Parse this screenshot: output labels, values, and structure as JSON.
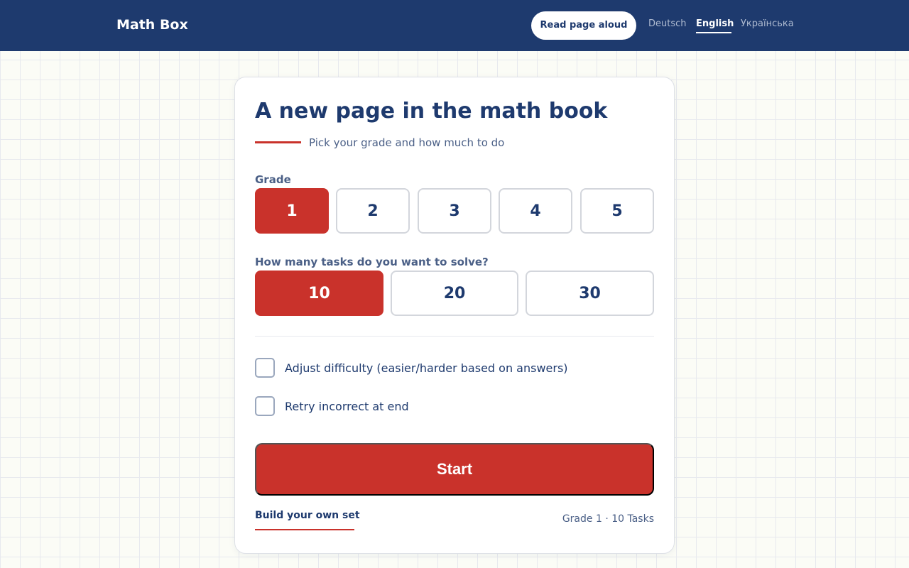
{
  "header": {
    "brand": "Math Box",
    "read_aloud_label": "Read page aloud",
    "languages": [
      {
        "label": "Deutsch",
        "active": false
      },
      {
        "label": "English",
        "active": true
      },
      {
        "label": "Українська",
        "active": false
      }
    ]
  },
  "card": {
    "title": "A new page in the math book",
    "subtitle": "Pick your grade and how much to do",
    "grade": {
      "label": "Grade",
      "options": [
        "1",
        "2",
        "3",
        "4",
        "5"
      ],
      "selected": "1"
    },
    "tasks": {
      "label": "How many tasks do you want to solve?",
      "options": [
        "10",
        "20",
        "30"
      ],
      "selected": "10"
    },
    "options": [
      {
        "label": "Adjust difficulty (easier/harder based on answers)",
        "checked": false
      },
      {
        "label": "Retry incorrect at end",
        "checked": false
      }
    ],
    "start_label": "Start",
    "build_own_label": "Build your own set",
    "summary": "Grade 1 · 10 Tasks"
  },
  "colors": {
    "header_bg": "#1e3a6e",
    "accent": "#c9322b",
    "text_primary": "#1e3a6e",
    "text_secondary": "#4a5f86"
  }
}
